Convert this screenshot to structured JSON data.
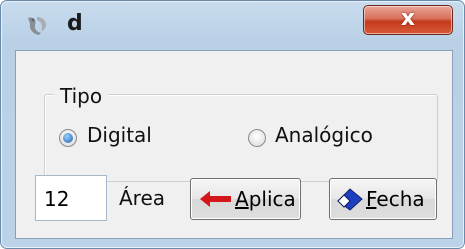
{
  "window": {
    "title": "d",
    "close_label": "x"
  },
  "tipo": {
    "legend": "Tipo",
    "options": [
      {
        "label": "Digital",
        "checked": true
      },
      {
        "label": "Analógico",
        "checked": false
      }
    ]
  },
  "area": {
    "value": "12",
    "label": "Área"
  },
  "buttons": {
    "aplica": {
      "first": "A",
      "rest": "plica",
      "icon": "red-left-arrow-icon"
    },
    "fecha": {
      "first": "F",
      "rest": "echa",
      "icon": "blue-eraser-icon"
    }
  },
  "colors": {
    "close_red": "#c43a1c",
    "arrow_red": "#d4161a",
    "eraser_blue": "#1f3fbf"
  }
}
